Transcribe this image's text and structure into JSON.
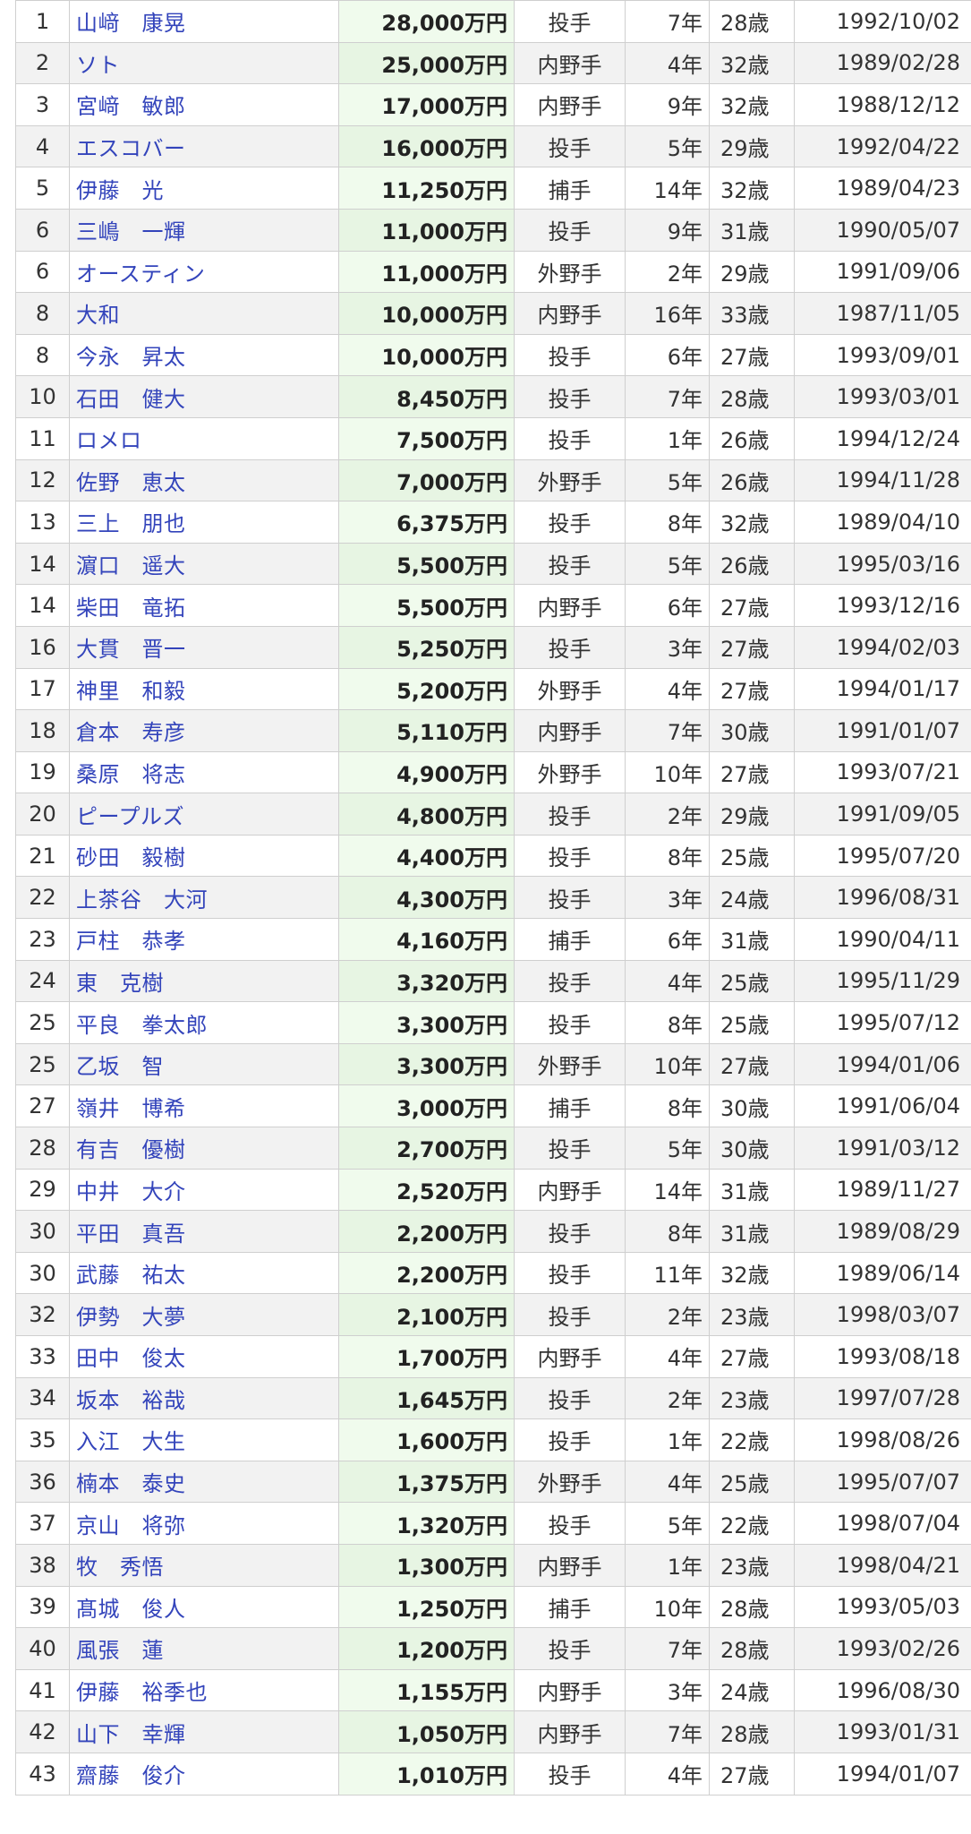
{
  "table": {
    "rows": [
      {
        "rank": "1",
        "name": "山﨑　康晃",
        "salary": "28,000万円",
        "position": "投手",
        "years": "7年",
        "age": "28歳",
        "birthdate": "1992/10/02"
      },
      {
        "rank": "2",
        "name": "ソト",
        "salary": "25,000万円",
        "position": "内野手",
        "years": "4年",
        "age": "32歳",
        "birthdate": "1989/02/28"
      },
      {
        "rank": "3",
        "name": "宮﨑　敏郎",
        "salary": "17,000万円",
        "position": "内野手",
        "years": "9年",
        "age": "32歳",
        "birthdate": "1988/12/12"
      },
      {
        "rank": "4",
        "name": "エスコバー",
        "salary": "16,000万円",
        "position": "投手",
        "years": "5年",
        "age": "29歳",
        "birthdate": "1992/04/22"
      },
      {
        "rank": "5",
        "name": "伊藤　光",
        "salary": "11,250万円",
        "position": "捕手",
        "years": "14年",
        "age": "32歳",
        "birthdate": "1989/04/23"
      },
      {
        "rank": "6",
        "name": "三嶋　一輝",
        "salary": "11,000万円",
        "position": "投手",
        "years": "9年",
        "age": "31歳",
        "birthdate": "1990/05/07"
      },
      {
        "rank": "6",
        "name": "オースティン",
        "salary": "11,000万円",
        "position": "外野手",
        "years": "2年",
        "age": "29歳",
        "birthdate": "1991/09/06"
      },
      {
        "rank": "8",
        "name": "大和",
        "salary": "10,000万円",
        "position": "内野手",
        "years": "16年",
        "age": "33歳",
        "birthdate": "1987/11/05"
      },
      {
        "rank": "8",
        "name": "今永　昇太",
        "salary": "10,000万円",
        "position": "投手",
        "years": "6年",
        "age": "27歳",
        "birthdate": "1993/09/01"
      },
      {
        "rank": "10",
        "name": "石田　健大",
        "salary": "8,450万円",
        "position": "投手",
        "years": "7年",
        "age": "28歳",
        "birthdate": "1993/03/01"
      },
      {
        "rank": "11",
        "name": "ロメロ",
        "salary": "7,500万円",
        "position": "投手",
        "years": "1年",
        "age": "26歳",
        "birthdate": "1994/12/24"
      },
      {
        "rank": "12",
        "name": "佐野　恵太",
        "salary": "7,000万円",
        "position": "外野手",
        "years": "5年",
        "age": "26歳",
        "birthdate": "1994/11/28"
      },
      {
        "rank": "13",
        "name": "三上　朋也",
        "salary": "6,375万円",
        "position": "投手",
        "years": "8年",
        "age": "32歳",
        "birthdate": "1989/04/10"
      },
      {
        "rank": "14",
        "name": "濵口　遥大",
        "salary": "5,500万円",
        "position": "投手",
        "years": "5年",
        "age": "26歳",
        "birthdate": "1995/03/16"
      },
      {
        "rank": "14",
        "name": "柴田　竜拓",
        "salary": "5,500万円",
        "position": "内野手",
        "years": "6年",
        "age": "27歳",
        "birthdate": "1993/12/16"
      },
      {
        "rank": "16",
        "name": "大貫　晋一",
        "salary": "5,250万円",
        "position": "投手",
        "years": "3年",
        "age": "27歳",
        "birthdate": "1994/02/03"
      },
      {
        "rank": "17",
        "name": "神里　和毅",
        "salary": "5,200万円",
        "position": "外野手",
        "years": "4年",
        "age": "27歳",
        "birthdate": "1994/01/17"
      },
      {
        "rank": "18",
        "name": "倉本　寿彦",
        "salary": "5,110万円",
        "position": "内野手",
        "years": "7年",
        "age": "30歳",
        "birthdate": "1991/01/07"
      },
      {
        "rank": "19",
        "name": "桑原　将志",
        "salary": "4,900万円",
        "position": "外野手",
        "years": "10年",
        "age": "27歳",
        "birthdate": "1993/07/21"
      },
      {
        "rank": "20",
        "name": "ピープルズ",
        "salary": "4,800万円",
        "position": "投手",
        "years": "2年",
        "age": "29歳",
        "birthdate": "1991/09/05"
      },
      {
        "rank": "21",
        "name": "砂田　毅樹",
        "salary": "4,400万円",
        "position": "投手",
        "years": "8年",
        "age": "25歳",
        "birthdate": "1995/07/20"
      },
      {
        "rank": "22",
        "name": "上茶谷　大河",
        "salary": "4,300万円",
        "position": "投手",
        "years": "3年",
        "age": "24歳",
        "birthdate": "1996/08/31"
      },
      {
        "rank": "23",
        "name": "戸柱　恭孝",
        "salary": "4,160万円",
        "position": "捕手",
        "years": "6年",
        "age": "31歳",
        "birthdate": "1990/04/11"
      },
      {
        "rank": "24",
        "name": "東　克樹",
        "salary": "3,320万円",
        "position": "投手",
        "years": "4年",
        "age": "25歳",
        "birthdate": "1995/11/29"
      },
      {
        "rank": "25",
        "name": "平良　拳太郎",
        "salary": "3,300万円",
        "position": "投手",
        "years": "8年",
        "age": "25歳",
        "birthdate": "1995/07/12"
      },
      {
        "rank": "25",
        "name": "乙坂　智",
        "salary": "3,300万円",
        "position": "外野手",
        "years": "10年",
        "age": "27歳",
        "birthdate": "1994/01/06"
      },
      {
        "rank": "27",
        "name": "嶺井　博希",
        "salary": "3,000万円",
        "position": "捕手",
        "years": "8年",
        "age": "30歳",
        "birthdate": "1991/06/04"
      },
      {
        "rank": "28",
        "name": "有吉　優樹",
        "salary": "2,700万円",
        "position": "投手",
        "years": "5年",
        "age": "30歳",
        "birthdate": "1991/03/12"
      },
      {
        "rank": "29",
        "name": "中井　大介",
        "salary": "2,520万円",
        "position": "内野手",
        "years": "14年",
        "age": "31歳",
        "birthdate": "1989/11/27"
      },
      {
        "rank": "30",
        "name": "平田　真吾",
        "salary": "2,200万円",
        "position": "投手",
        "years": "8年",
        "age": "31歳",
        "birthdate": "1989/08/29"
      },
      {
        "rank": "30",
        "name": "武藤　祐太",
        "salary": "2,200万円",
        "position": "投手",
        "years": "11年",
        "age": "32歳",
        "birthdate": "1989/06/14"
      },
      {
        "rank": "32",
        "name": "伊勢　大夢",
        "salary": "2,100万円",
        "position": "投手",
        "years": "2年",
        "age": "23歳",
        "birthdate": "1998/03/07"
      },
      {
        "rank": "33",
        "name": "田中　俊太",
        "salary": "1,700万円",
        "position": "内野手",
        "years": "4年",
        "age": "27歳",
        "birthdate": "1993/08/18"
      },
      {
        "rank": "34",
        "name": "坂本　裕哉",
        "salary": "1,645万円",
        "position": "投手",
        "years": "2年",
        "age": "23歳",
        "birthdate": "1997/07/28"
      },
      {
        "rank": "35",
        "name": "入江　大生",
        "salary": "1,600万円",
        "position": "投手",
        "years": "1年",
        "age": "22歳",
        "birthdate": "1998/08/26"
      },
      {
        "rank": "36",
        "name": "楠本　泰史",
        "salary": "1,375万円",
        "position": "外野手",
        "years": "4年",
        "age": "25歳",
        "birthdate": "1995/07/07"
      },
      {
        "rank": "37",
        "name": "京山　将弥",
        "salary": "1,320万円",
        "position": "投手",
        "years": "5年",
        "age": "22歳",
        "birthdate": "1998/07/04"
      },
      {
        "rank": "38",
        "name": "牧　秀悟",
        "salary": "1,300万円",
        "position": "内野手",
        "years": "1年",
        "age": "23歳",
        "birthdate": "1998/04/21"
      },
      {
        "rank": "39",
        "name": "髙城　俊人",
        "salary": "1,250万円",
        "position": "捕手",
        "years": "10年",
        "age": "28歳",
        "birthdate": "1993/05/03"
      },
      {
        "rank": "40",
        "name": "風張　蓮",
        "salary": "1,200万円",
        "position": "投手",
        "years": "7年",
        "age": "28歳",
        "birthdate": "1993/02/26"
      },
      {
        "rank": "41",
        "name": "伊藤　裕季也",
        "salary": "1,155万円",
        "position": "内野手",
        "years": "3年",
        "age": "24歳",
        "birthdate": "1996/08/30"
      },
      {
        "rank": "42",
        "name": "山下　幸輝",
        "salary": "1,050万円",
        "position": "内野手",
        "years": "7年",
        "age": "28歳",
        "birthdate": "1993/01/31"
      },
      {
        "rank": "43",
        "name": "齋藤　俊介",
        "salary": "1,010万円",
        "position": "投手",
        "years": "4年",
        "age": "27歳",
        "birthdate": "1994/01/07"
      }
    ]
  },
  "colors": {
    "link": "#3344bb",
    "salary_bg": "#f0fbed",
    "row_alt_bg": "#f2f2f2",
    "border": "#cfcfcf"
  }
}
